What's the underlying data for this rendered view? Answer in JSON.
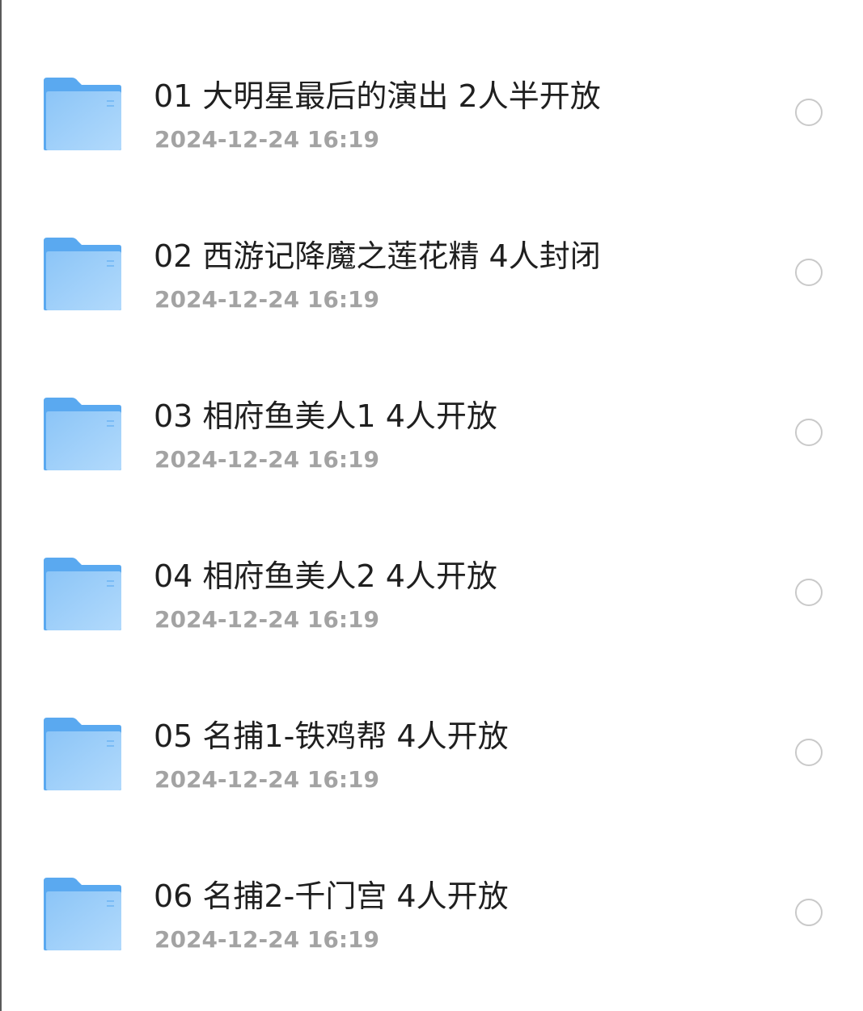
{
  "files": [
    {
      "title": "01 大明星最后的演出 2人半开放",
      "date": "2024-12-24 16:19",
      "icon": "folder-icon"
    },
    {
      "title": "02 西游记降魔之莲花精 4人封闭",
      "date": "2024-12-24 16:19",
      "icon": "folder-icon"
    },
    {
      "title": "03 相府鱼美人1 4人开放",
      "date": "2024-12-24 16:19",
      "icon": "folder-icon"
    },
    {
      "title": "04 相府鱼美人2 4人开放",
      "date": "2024-12-24 16:19",
      "icon": "folder-icon"
    },
    {
      "title": "05 名捕1-铁鸡帮 4人开放",
      "date": "2024-12-24 16:19",
      "icon": "folder-icon"
    },
    {
      "title": "06 名捕2-千门宫 4人开放",
      "date": "2024-12-24 16:19",
      "icon": "folder-icon"
    }
  ],
  "colors": {
    "folder_back": "#5aa9f0",
    "folder_front": "#9fd0fb",
    "title_text": "#1f1f1f",
    "date_text": "#a3a3a3",
    "checkbox_border": "#c9c9c9"
  }
}
